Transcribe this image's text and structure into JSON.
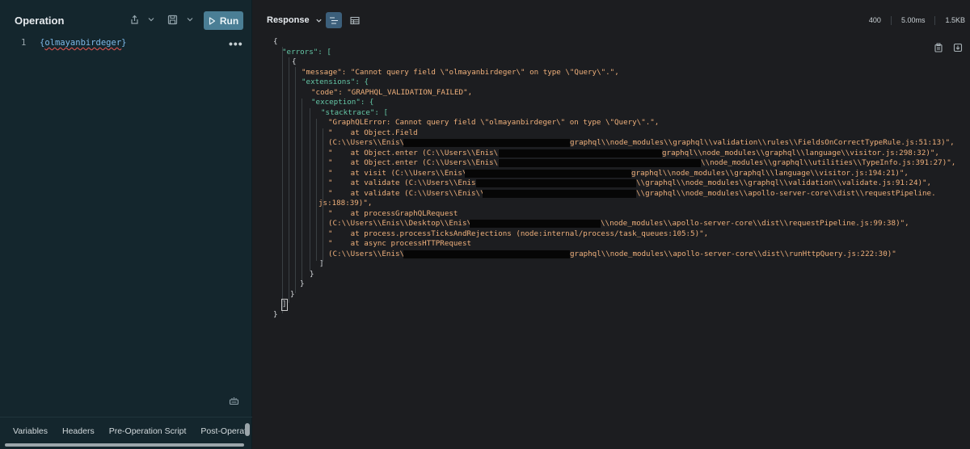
{
  "operation": {
    "title": "Operation",
    "run_label": "Run",
    "line_number": "1",
    "query_open": "{",
    "query_field": "olmayanbirdeger",
    "query_close": "}",
    "more_label": "•••",
    "tabs": [
      "Variables",
      "Headers",
      "Pre-Operation Script",
      "Post-Operati"
    ]
  },
  "response": {
    "title": "Response",
    "status": "400",
    "time": "5.00ms",
    "size": "1.5KB",
    "json_lines": [
      "{",
      "\"errors\": [",
      "{",
      "\"message\": \"Cannot query field \\\"olmayanbirdeger\\\" on type \\\"Query\\\".\",",
      "\"extensions\": {",
      "\"code\": \"GRAPHQL_VALIDATION_FAILED\",",
      "\"exception\": {",
      "\"stacktrace\": [",
      "\"GraphQLError: Cannot query field \\\"olmayanbirdeger\\\" on type \\\"Query\\\".\",",
      "\"    at Object.Field",
      "(C:\\\\Users\\\\Enis\\\\",
      "graphql\\\\node_modules\\\\graphql\\\\validation\\\\rules\\\\FieldsOnCorrectTypeRule.js:51:13)\",",
      "\"    at Object.enter (C:\\\\Users\\\\Enis\\\\",
      "graphql\\\\node_modules\\\\graphql\\\\language\\\\visitor.js:298:32)\",",
      "\"    at Object.enter (C:\\\\Users\\\\Enis\\\\",
      "\\\\node_modules\\\\graphql\\\\utilities\\\\TypeInfo.js:391:27)\",",
      "\"    at visit (C:\\\\Users\\\\Enis\\\\",
      "graphql\\\\node_modules\\\\graphql\\\\language\\\\visitor.js:194:21)\",",
      "\"    at validate (C:\\\\Users\\\\Enis\\\\",
      "\\\\graphql\\\\node_modules\\\\graphql\\\\validation\\\\validate.js:91:24)\",",
      "\"    at validate (C:\\\\Users\\\\Enis\\\\",
      "\\\\graphql\\\\node_modules\\\\apollo-server-core\\\\dist\\\\requestPipeline.",
      "js:188:39)\",",
      "\"    at processGraphQLRequest",
      "(C:\\\\Users\\\\Enis\\\\Desktop\\\\Enis\\\\",
      "\\\\node_modules\\\\apollo-server-core\\\\dist\\\\requestPipeline.js:99:38)\",",
      "\"    at process.processTicksAndRejections (node:internal/process/task_queues:105:5)\",",
      "\"    at async processHTTPRequest",
      "(C:\\\\Users\\\\Enis\\\\",
      "graphql\\\\node_modules\\\\apollo-server-core\\\\dist\\\\runHttpQuery.js:222:30)\"",
      "]",
      "}",
      "}",
      "}",
      "]",
      "}"
    ]
  }
}
